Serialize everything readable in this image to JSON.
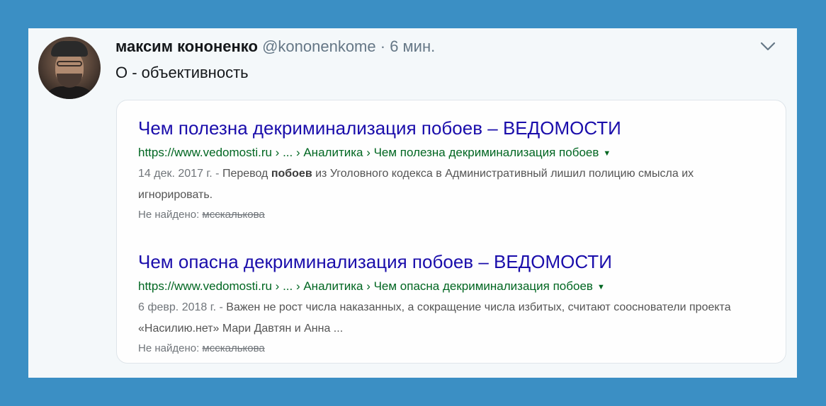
{
  "tweet": {
    "display_name": "максим кононенко",
    "handle": "@kononenkome",
    "separator": "·",
    "time": "6 мин.",
    "text": "О - объективность"
  },
  "icons": {
    "avatar": "user-avatar-photo",
    "menu": "chevron-down-icon",
    "url_dropdown": "triangle-down-icon"
  },
  "search_results": [
    {
      "title": "Чем полезна декриминализация побоев – ВЕДОМОСТИ",
      "url": "https://www.vedomosti.ru › ... › Аналитика › Чем полезна декриминализация побоев",
      "date": "14 дек. 2017 г. -",
      "snippet_pre": "Перевод",
      "snippet_bold": "побоев",
      "snippet_post": "из Уголовного кодекса в Административный лишил полицию смысла их игнорировать.",
      "missing_label": "Не найдено:",
      "missing_term": "мсскалькова"
    },
    {
      "title": "Чем опасна декриминализация побоев – ВЕДОМОСТИ",
      "url": "https://www.vedomosti.ru › ... › Аналитика › Чем опасна декриминализация побоев",
      "date": "6 февр. 2018 г. -",
      "snippet_pre": "Важен не рост числа наказанных, а сокращение числа избитых, считают сооснователи проекта «Насилию.нет» Мари Давтян и Анна ...",
      "snippet_bold": "",
      "snippet_post": "",
      "missing_label": "Не найдено:",
      "missing_term": "мсскалькова"
    }
  ],
  "colors": {
    "background": "#3b8fc4",
    "card": "#f4f8fa",
    "link_title": "#1a0dab",
    "link_url": "#006621",
    "muted": "#657786"
  }
}
